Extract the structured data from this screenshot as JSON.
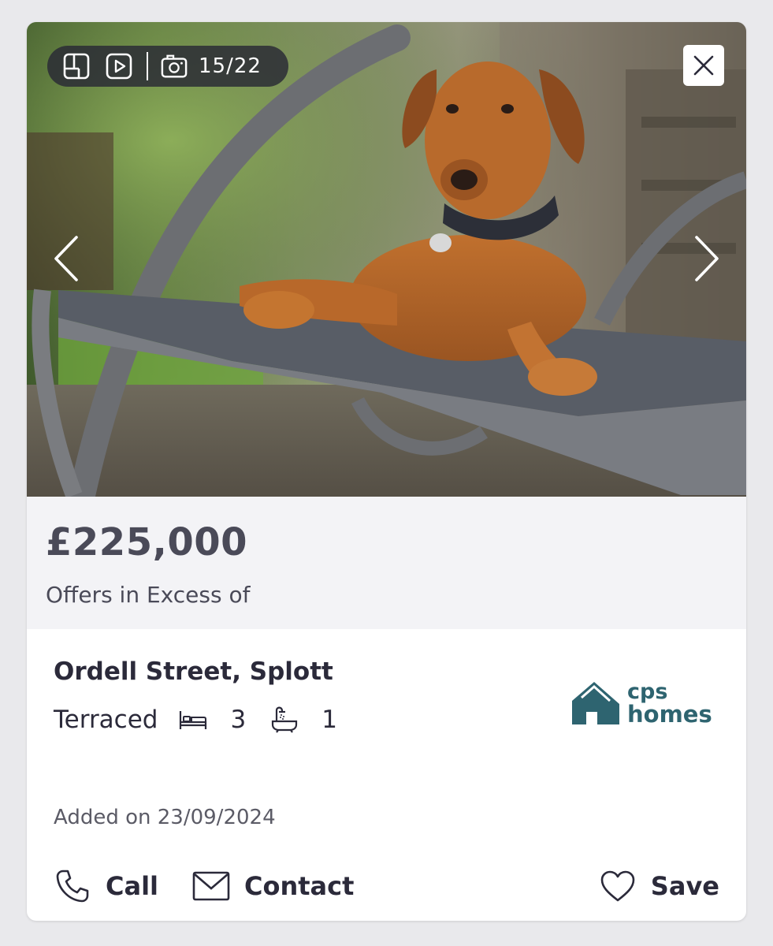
{
  "gallery": {
    "icons": [
      "floorplan-icon",
      "video-play-icon",
      "camera-icon"
    ],
    "counter": "15/22",
    "close_icon": "close-icon",
    "prev_icon": "chevron-left-icon",
    "next_icon": "chevron-right-icon"
  },
  "listing": {
    "price": "£225,000",
    "price_qualifier": "Offers in Excess of",
    "address": "Ordell Street, Splott",
    "property_type": "Terraced",
    "bedrooms": "3",
    "bathrooms": "1",
    "added": "Added on 23/09/2024"
  },
  "agent": {
    "logo_line1": "cps",
    "logo_line2": "homes",
    "brand_color": "#2e6470"
  },
  "actions": {
    "call_label": "Call",
    "contact_label": "Contact",
    "save_label": "Save"
  },
  "colors": {
    "price_band": "#f3f3f6",
    "text_dark": "#2b2a3a",
    "pill_bg": "#282834"
  }
}
